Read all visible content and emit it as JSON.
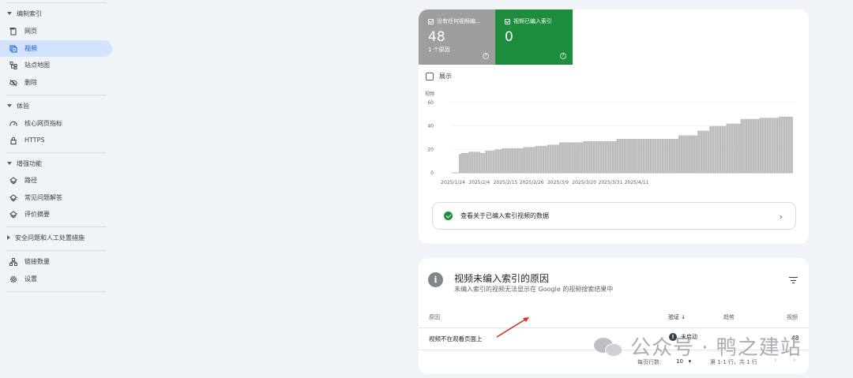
{
  "sidebar": {
    "sections": [
      {
        "label": "编制索引",
        "items": [
          "网页",
          "视频",
          "站点地图",
          "删除"
        ]
      },
      {
        "label": "体验",
        "items": [
          "核心网页指标",
          "HTTPS"
        ]
      },
      {
        "label": "增强功能",
        "items": [
          "路径",
          "常见问题解答",
          "评价摘要"
        ]
      },
      {
        "label": "安全问题和人工处置措施",
        "items": []
      },
      {
        "label": "",
        "items": [
          "链接数量",
          "设置"
        ]
      }
    ],
    "active_item": "视频"
  },
  "summary": {
    "not_indexed": {
      "label": "没有任何视频编...",
      "value": "48",
      "sub": "1 个原因"
    },
    "indexed": {
      "label": "视频已编入索引",
      "value": "0"
    }
  },
  "show_label": "展示",
  "view_link": "查看关于已编入索引视频的数据",
  "chart_data": {
    "type": "bar",
    "ylabel": "视频",
    "ylim": [
      0,
      60
    ],
    "yticks": [
      0,
      20,
      40,
      60
    ],
    "xtick_labels": [
      "2025/1/24",
      "2025/2/4",
      "2025/2/15",
      "2025/2/26",
      "2025/3/9",
      "2025/3/20",
      "2025/3/31",
      "2025/4/11"
    ],
    "start_date": "2025/1/24",
    "values": [
      0,
      0,
      0,
      16,
      17,
      17,
      17,
      18,
      18,
      18,
      18,
      18,
      17,
      17,
      19,
      19,
      19,
      19,
      20,
      20,
      20,
      21,
      21,
      21,
      21,
      21,
      21,
      21,
      21,
      21,
      22,
      22,
      22,
      22,
      22,
      23,
      23,
      23,
      23,
      23,
      24,
      24,
      24,
      24,
      24,
      26,
      26,
      26,
      26,
      26,
      26,
      26,
      26,
      26,
      26,
      27,
      27,
      27,
      27,
      27,
      27,
      27,
      27,
      27,
      27,
      27,
      27,
      27,
      27,
      29,
      29,
      29,
      29,
      29,
      29,
      29,
      29,
      29,
      29,
      29,
      29,
      29,
      29,
      29,
      29,
      29,
      29,
      29,
      29,
      29,
      29,
      29,
      29,
      29,
      29,
      32,
      32,
      32,
      32,
      32,
      32,
      32,
      32,
      36,
      36,
      36,
      36,
      36,
      40,
      40,
      40,
      40,
      40,
      40,
      40,
      42,
      42,
      42,
      42,
      42,
      42,
      46,
      46,
      46,
      46,
      46,
      46,
      46,
      46,
      47,
      47,
      47,
      47,
      47,
      47,
      47,
      47,
      48,
      48,
      48,
      48,
      48,
      48
    ]
  },
  "reasons": {
    "title": "视频未编入索引的原因",
    "subtitle": "未编入索引的视频无法显示在 Google 的视频搜索结果中",
    "columns": {
      "reason": "原因",
      "validation": "验证",
      "trend": "趋势",
      "videos": "视频"
    },
    "rows": [
      {
        "reason": "视频不在观看页面上",
        "status": "未启动",
        "videos": "48"
      }
    ],
    "pager": {
      "rows_label": "每页行数:",
      "rows_value": "10",
      "range": "第 1-1 行，共 1 行"
    }
  },
  "watermark": "公众号 · 鸭之建站"
}
